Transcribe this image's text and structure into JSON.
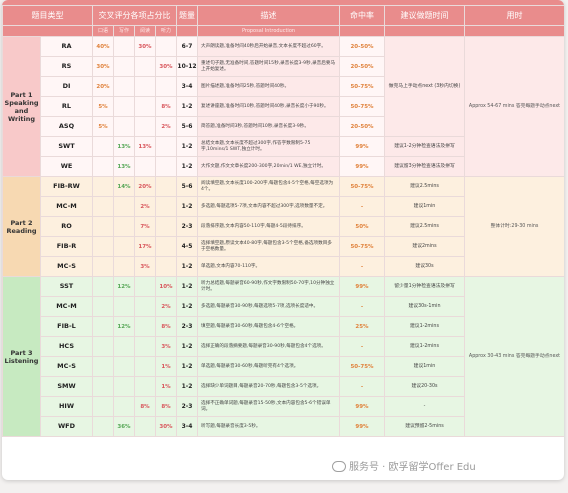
{
  "header": {
    "type": "题目类型",
    "weights": "交叉评分各项占分比",
    "weights_sub": [
      "口语",
      "写作",
      "阅读",
      "听力"
    ],
    "count": "题量",
    "desc": "描述",
    "hit": "命中率",
    "tip": "建议做题时间",
    "duration": "用时",
    "desc_sub": "Proposal Introduction"
  },
  "parts": [
    {
      "name": "Part 1 Speaking and Writing",
      "duration": "Approx 54-67 mins 答完每题手动点next"
    },
    {
      "name": "Part 2 Reading",
      "duration": "整体计时:29-30 mins"
    },
    {
      "name": "Part 3 Listening",
      "duration": "Approx 30-43 mins 答完每题手动点next"
    }
  ],
  "rows": [
    {
      "code": "RA",
      "w": [
        "40%",
        "",
        "30%",
        ""
      ],
      "count": "6-7",
      "desc": "大声朗读题,准备时间40秒后开始录音,文本长度不超过60字。",
      "hit": "20-50%",
      "tip": "做完马上手动点next (3秒内切换)"
    },
    {
      "code": "RS",
      "w": [
        "30%",
        "",
        "",
        "30%"
      ],
      "count": "10-12",
      "desc": "重述句子题,无准备时间,答题时间15秒,录音长度3-9秒,录音后要马上开始复述。",
      "hit": "20-50%",
      "tip": ""
    },
    {
      "code": "DI",
      "w": [
        "20%",
        "",
        "",
        ""
      ],
      "count": "3-4",
      "desc": "图片描述题,准备时间25秒,答题时间40秒。",
      "hit": "50-75%",
      "tip": ""
    },
    {
      "code": "RL",
      "w": [
        "5%",
        "",
        "",
        "8%"
      ],
      "count": "1-2",
      "desc": "复述讲座题,准备时间10秒,答题时间40秒,录音长度小于90秒。",
      "hit": "50-75%",
      "tip": ""
    },
    {
      "code": "ASQ",
      "w": [
        "5%",
        "",
        "",
        "2%"
      ],
      "count": "5-6",
      "desc": "简答题,准备时间3秒,答题时间10秒,录音长度3-9秒。",
      "hit": "20-50%",
      "tip": ""
    },
    {
      "code": "SWT",
      "w": [
        "",
        "13%",
        "13%",
        ""
      ],
      "count": "1-2",
      "desc": "总结文本题,文本长度不超过300字,作答字数限制5-75字,10mins/1 SWT,独立计时。",
      "hit": "99%",
      "tip": "建议1-2分钟检查语法及拼写"
    },
    {
      "code": "WE",
      "w": [
        "",
        "13%",
        "",
        ""
      ],
      "count": "1-2",
      "desc": "大作文题,作文文章长度200-300字,20min/1 WE,独立计时。",
      "hit": "99%",
      "tip": "建议留3分钟检查语法及拼写"
    },
    {
      "code": "FIB-RW",
      "w": [
        "",
        "14%",
        "20%",
        ""
      ],
      "count": "5-6",
      "desc": "阅读填空题,文本长度100-200字,每题包含4-5个空格,每空选项为4个。",
      "hit": "50-75%",
      "tip": "建议2.5mins"
    },
    {
      "code": "MC-M",
      "w": [
        "",
        "",
        "2%",
        ""
      ],
      "count": "1-2",
      "desc": "多选题,每题选项5-7项,文本内容不超过300字,选项数量不定。",
      "hit": "-",
      "tip": "建议1min"
    },
    {
      "code": "RO",
      "w": [
        "",
        "",
        "7%",
        ""
      ],
      "count": "2-3",
      "desc": "段落排序题,文本内容50-110字,每题4-5段待排序。",
      "hit": "50%",
      "tip": "建议2.5mins"
    },
    {
      "code": "FIB-R",
      "w": [
        "",
        "",
        "17%",
        ""
      ],
      "count": "4-5",
      "desc": "选择填空题,原读文本40-80字,每题包含3-5个空格,备选项数目多于空格数量。",
      "hit": "50-75%",
      "tip": "建议2mins"
    },
    {
      "code": "MC-S",
      "w": [
        "",
        "",
        "3%",
        ""
      ],
      "count": "1-2",
      "desc": "单选题,文本内容70-110字。",
      "hit": "-",
      "tip": "建议30s"
    },
    {
      "code": "SST",
      "w": [
        "",
        "12%",
        "",
        "10%"
      ],
      "count": "1-2",
      "desc": "听力总结题,每题录音60-90秒,作文字数限制50-70字,10分钟独立计时。",
      "hit": "99%",
      "tip": "留少量1分钟检查语法及拼写"
    },
    {
      "code": "MC-M",
      "w": [
        "",
        "",
        "",
        "2%"
      ],
      "count": "1-2",
      "desc": "多选题,每题录音30-90秒,每题选项5-7项,选项长度适中。",
      "hit": "-",
      "tip": "建议30s-1min"
    },
    {
      "code": "FIB-L",
      "w": [
        "",
        "12%",
        "",
        "8%"
      ],
      "count": "2-3",
      "desc": "填空题,每题录音30-60秒,每题包含4-6个空格。",
      "hit": "25%",
      "tip": "建议1-2mins"
    },
    {
      "code": "HCS",
      "w": [
        "",
        "",
        "",
        "3%"
      ],
      "count": "1-2",
      "desc": "选择正确的段落摘要题,每题录音30-90秒,每题包含4个选项。",
      "hit": "-",
      "tip": "建议1-2mins"
    },
    {
      "code": "MC-S",
      "w": [
        "",
        "",
        "",
        "1%"
      ],
      "count": "1-2",
      "desc": "单选题,每题录音30-60秒,每题听完有4个选项。",
      "hit": "50-75%",
      "tip": "建议1min"
    },
    {
      "code": "SMW",
      "w": [
        "",
        "",
        "",
        "1%"
      ],
      "count": "1-2",
      "desc": "选择缺少单词题目,每题录音20-70秒,每题包含3-5个选项。",
      "hit": "-",
      "tip": "建议20-30s"
    },
    {
      "code": "HIW",
      "w": [
        "",
        "",
        "8%",
        "8%"
      ],
      "count": "2-3",
      "desc": "选择不正确单词题,每题录音15-50秒,文本内容包含5-6个错误单词。",
      "hit": "99%",
      "tip": "-"
    },
    {
      "code": "WFD",
      "w": [
        "",
        "36%",
        "",
        "30%"
      ],
      "count": "3-4",
      "desc": "听写题,每题录音长度3-5秒。",
      "hit": "99%",
      "tip": "建议预留2-5mins"
    }
  ],
  "watermark": "服务号 · 欧孚留学Offer Edu",
  "colors": {
    "header": "#e98c8c",
    "speaking": "#fde9e9",
    "reading": "#fdf0df",
    "listening": "#e7f6e3",
    "accent": "#e0823c"
  }
}
